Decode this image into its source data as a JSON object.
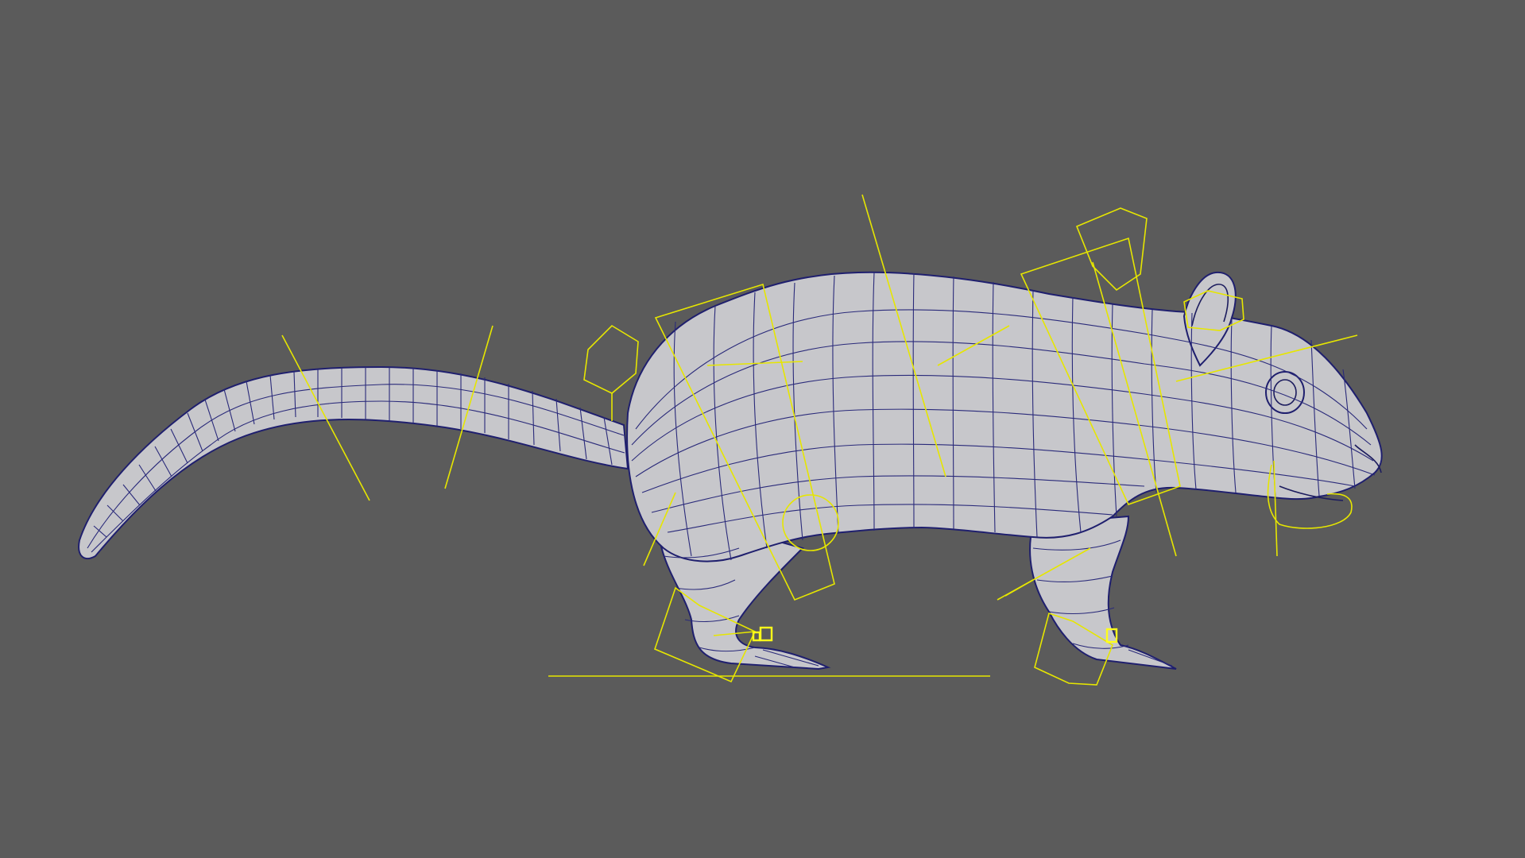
{
  "viewport": {
    "background": "#5b5b5b",
    "subject": "rat",
    "display_mode": "wireframe-on-shaded",
    "mesh_color": "#c7c7cb",
    "wire_color": "#2a2a7a",
    "rig_color": "#e6e600"
  }
}
